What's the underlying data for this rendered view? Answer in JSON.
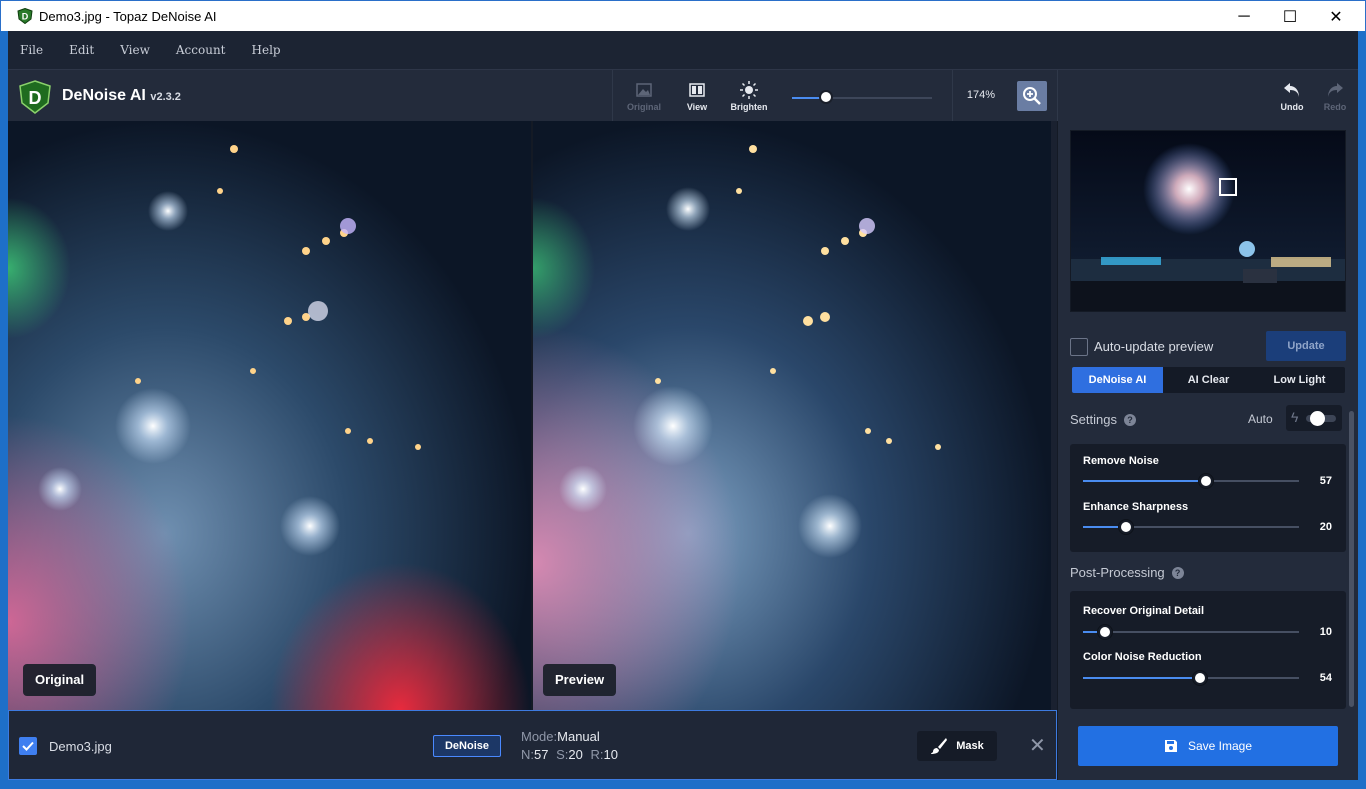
{
  "window": {
    "title": "Demo3.jpg - Topaz DeNoise AI",
    "minimize": "─",
    "maximize": "☐",
    "close": "✕"
  },
  "menu": [
    "File",
    "Edit",
    "View",
    "Account",
    "Help"
  ],
  "toolbar": {
    "brand": "DeNoise AI",
    "version": "v2.3.2",
    "original_label": "Original",
    "view_label": "View",
    "brighten_label": "Brighten",
    "zoom_value": "174%",
    "zoom_fraction": 0.24,
    "undo_label": "Undo",
    "redo_label": "Redo"
  },
  "views": {
    "left_label": "Original",
    "right_label": "Preview"
  },
  "file": {
    "name": "Demo3.jpg",
    "checked": true,
    "tag": "DeNoise",
    "mode_key": "Mode:",
    "mode_value": "Manual",
    "n_key": "N:",
    "n_value": "57",
    "s_key": "S:",
    "s_value": "20",
    "r_key": "R:",
    "r_value": "10",
    "mask_label": "Mask"
  },
  "panel": {
    "auto_update_label": "Auto-update preview",
    "update_button": "Update",
    "modes": [
      "DeNoise AI",
      "AI Clear",
      "Low Light"
    ],
    "active_mode": "DeNoise AI",
    "settings_title": "Settings",
    "auto_label": "Auto",
    "sliders": [
      {
        "label": "Remove Noise",
        "value": 57
      },
      {
        "label": "Enhance Sharpness",
        "value": 20
      }
    ],
    "post_title": "Post-Processing",
    "post_sliders": [
      {
        "label": "Recover Original Detail",
        "value": 10
      },
      {
        "label": "Color Noise Reduction",
        "value": 54
      }
    ],
    "save_button": "Save Image"
  },
  "colors": {
    "accent": "#2f6fe0",
    "panel_bg": "#232b3b",
    "menubar_bg": "#1c2433"
  }
}
